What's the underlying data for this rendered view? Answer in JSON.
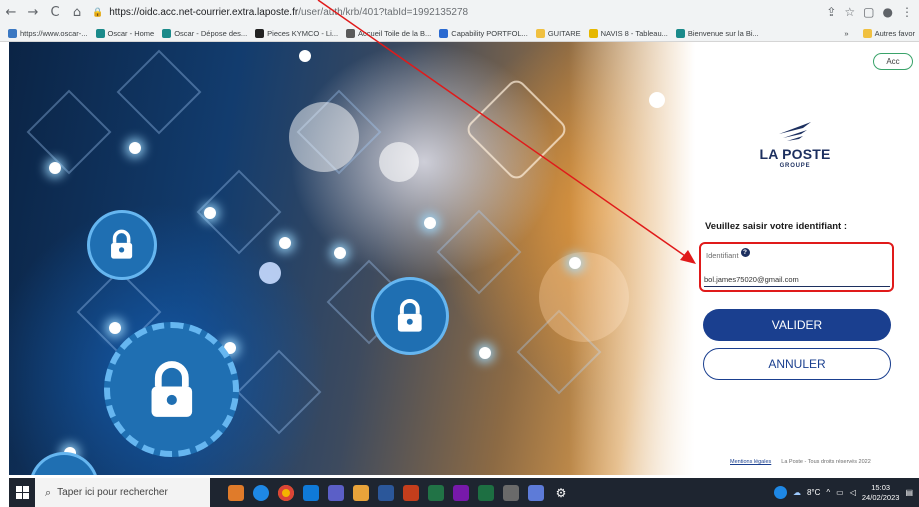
{
  "browser": {
    "url_main": "https://oidc.acc.net-courrier.extra.laposte.fr",
    "url_rest": "/user/auth/krb/401?tabId=1992135278",
    "nav": [
      "←",
      "→",
      "C",
      "⌂"
    ],
    "icons": [
      "share-icon",
      "star-icon",
      "sidepanel-icon",
      "profile-icon",
      "menu-icon"
    ]
  },
  "bookmarks": [
    {
      "label": "https://www.oscar-...",
      "color": "#3b78c2"
    },
    {
      "label": "Oscar - Home",
      "color": "#1a8a8a"
    },
    {
      "label": "Oscar - Dépose des...",
      "color": "#1a8a8a"
    },
    {
      "label": "Pieces KYMCO - Li...",
      "color": "#222222"
    },
    {
      "label": "Accueil Toile de la B...",
      "color": "#5a5a5a"
    },
    {
      "label": "Capability PORTFOL...",
      "color": "#2a6ad1"
    },
    {
      "label": "GUITARE",
      "color": "#f0c040"
    },
    {
      "label": "NAVIS 8 - Tableau...",
      "color": "#e6b800"
    },
    {
      "label": "Bienvenue sur la Bi...",
      "color": "#1a8a8a"
    }
  ],
  "bookmarks_more": "»",
  "bookmarks_other": "Autres favor",
  "panel": {
    "acc_button": "Acc",
    "logo_brand": "LA POSTE",
    "logo_sub": "GROUPE",
    "prompt": "Veuillez saisir votre identifiant :",
    "field_label": "Identifiant",
    "help_symbol": "?",
    "field_value": "bol.james75020@gmail.com",
    "valider": "VALIDER",
    "annuler": "ANNULER",
    "footer_link": "Mentions légales",
    "footer_text": "La Poste - Tous droits réservés 2022"
  },
  "taskbar": {
    "search_placeholder": "Taper ici pour rechercher",
    "apps": [
      "#e07b2a",
      "#1e88e5",
      "#f4b400",
      "#0f7ad8",
      "#5b5fc7",
      "#e8a33a",
      "#2b579a",
      "#c43e1c",
      "#217346",
      "#7719aa",
      "#185abd",
      "#6a6a6a",
      "#5d7bd8",
      "#d9d9d9"
    ],
    "weather": "8°C",
    "time": "15:03",
    "date": "24/02/2023"
  }
}
